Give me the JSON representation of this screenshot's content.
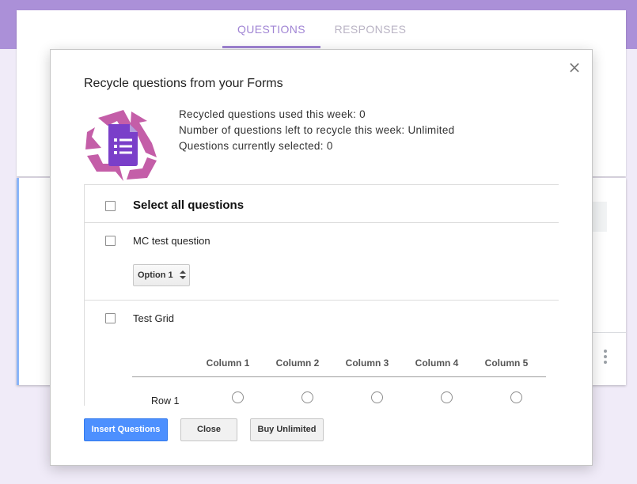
{
  "tabs": {
    "questions": "QUESTIONS",
    "responses": "RESPONSES"
  },
  "dialog": {
    "title": "Recycle questions from your Forms",
    "close_glyph": "×",
    "stats": [
      "Recycled questions used this week: 0",
      "Number of questions left to recycle this week: Unlimited",
      "Questions currently selected: 0"
    ],
    "select_all_label": "Select all questions",
    "questions": [
      {
        "title": "MC test question",
        "selected_option": "Option 1"
      },
      {
        "title": "Test Grid",
        "columns": [
          "Column 1",
          "Column 2",
          "Column 3",
          "Column 4",
          "Column 5"
        ],
        "rows": [
          "Row 1"
        ]
      }
    ],
    "buttons": {
      "insert": "Insert Questions",
      "close": "Close",
      "buy": "Buy Unlimited"
    }
  },
  "colors": {
    "header": "#ab90d8",
    "accent": "#a084d4",
    "primary_button": "#4d90fe",
    "logo_recycle": "#c45ea8",
    "logo_form": "#7a3fc9"
  },
  "icons": {
    "logo": "recycle-forms-logo-icon",
    "close": "close-icon",
    "more": "more-vert-icon"
  }
}
